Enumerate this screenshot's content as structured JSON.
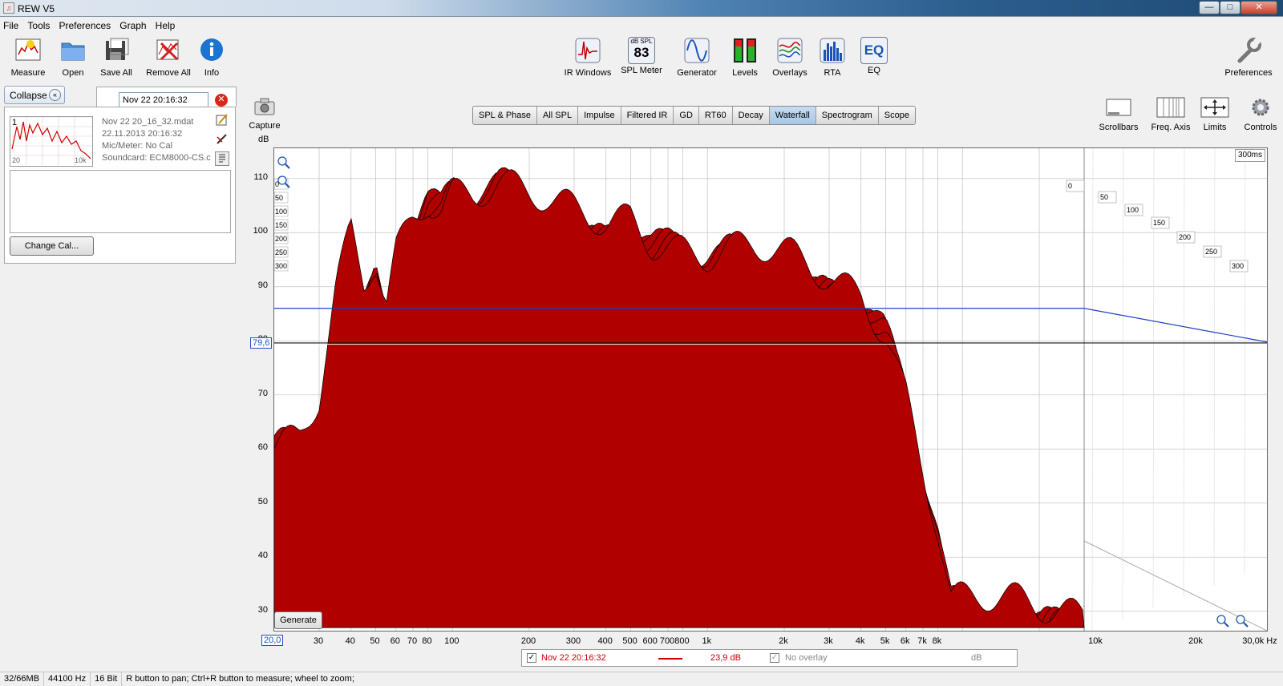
{
  "window": {
    "title": "REW V5",
    "min_glyph": "—",
    "max_glyph": "□",
    "close_glyph": "✕"
  },
  "menu": [
    "File",
    "Tools",
    "Preferences",
    "Graph",
    "Help"
  ],
  "toolbar_left": [
    {
      "label": "Measure",
      "icon": "measure-icon"
    },
    {
      "label": "Open",
      "icon": "folder-open-icon"
    },
    {
      "label": "Save All",
      "icon": "save-icon"
    },
    {
      "label": "Remove All",
      "icon": "remove-all-icon"
    },
    {
      "label": "Info",
      "icon": "info-icon"
    }
  ],
  "toolbar_center": [
    {
      "label": "IR Windows",
      "icon": "ir-windows-icon"
    },
    {
      "label": "SPL Meter",
      "icon": "spl-meter-icon",
      "badge_top": "dB SPL",
      "badge_value": "83"
    },
    {
      "label": "Generator",
      "icon": "generator-icon"
    },
    {
      "label": "Levels",
      "icon": "levels-icon"
    },
    {
      "label": "Overlays",
      "icon": "overlays-icon"
    },
    {
      "label": "RTA",
      "icon": "rta-icon"
    },
    {
      "label": "EQ",
      "icon": "eq-icon",
      "badge_value": "EQ"
    }
  ],
  "toolbar_right": {
    "label": "Preferences",
    "icon": "wrench-icon"
  },
  "graph_controls": [
    {
      "label": "Scrollbars",
      "icon": "scrollbars-icon"
    },
    {
      "label": "Freq. Axis",
      "icon": "freq-axis-icon"
    },
    {
      "label": "Limits",
      "icon": "limits-icon"
    },
    {
      "label": "Controls",
      "icon": "gear-icon"
    }
  ],
  "capture": {
    "label": "Capture",
    "icon": "camera-icon"
  },
  "left_panel": {
    "collapse_label": "Collapse",
    "measurement_name": "Nov 22 20:16:32",
    "thumb_index": "1",
    "thumb_x_min": "20",
    "thumb_x_max": "10k",
    "info": [
      "Nov 22 20_16_32.mdat",
      "22.11.2013 20:16:32",
      "Mic/Meter: No Cal",
      "Soundcard: ECM8000-CS.c"
    ],
    "change_cal_label": "Change Cal..."
  },
  "graph_tabs": [
    {
      "label": "SPL & Phase",
      "active": false
    },
    {
      "label": "All SPL",
      "active": false
    },
    {
      "label": "Impulse",
      "active": false
    },
    {
      "label": "Filtered IR",
      "active": false
    },
    {
      "label": "GD",
      "active": false
    },
    {
      "label": "RT60",
      "active": false
    },
    {
      "label": "Decay",
      "active": false
    },
    {
      "label": "Waterfall",
      "active": true
    },
    {
      "label": "Spectrogram",
      "active": false
    },
    {
      "label": "Scope",
      "active": false
    }
  ],
  "chart_data": {
    "type": "area",
    "ylabel": "dB",
    "y_ticks": [
      "110",
      "100",
      "90",
      "80",
      "70",
      "60",
      "50",
      "40",
      "30"
    ],
    "ylim": [
      27,
      115
    ],
    "x_scale": "log",
    "x_ticks": [
      "30",
      "40",
      "50",
      "60",
      "70",
      "80",
      "100",
      "200",
      "300",
      "400",
      "500",
      "600",
      "700",
      "800",
      "1k",
      "2k",
      "3k",
      "4k",
      "5k",
      "6k",
      "7k",
      "8k",
      "10k",
      "20k",
      "30,0k Hz"
    ],
    "x_tick_values": [
      30,
      40,
      50,
      60,
      70,
      80,
      100,
      200,
      300,
      400,
      500,
      600,
      700,
      800,
      1000,
      2000,
      3000,
      4000,
      5000,
      6000,
      7000,
      8000,
      10000,
      20000,
      30000
    ],
    "xlim": [
      20,
      30000
    ],
    "x_min_label": "20,0",
    "y_marker_label": "79,6",
    "y_marker_value": 79.6,
    "limit_line_value": 86,
    "time_window_label": "300ms",
    "time_slices": [
      "0",
      "50",
      "100",
      "150",
      "200",
      "250",
      "300"
    ],
    "fill_color": "#b00000",
    "line_color": "#000000",
    "front_slice": {
      "freqs": [
        20,
        25,
        30,
        35,
        40,
        45,
        50,
        55,
        60,
        70,
        80,
        90,
        100,
        120,
        150,
        200,
        250,
        300,
        400,
        500,
        600,
        700,
        800,
        1000,
        1500,
        2000,
        3000,
        4000,
        5000,
        6000,
        7000,
        8000,
        9000
      ],
      "db": [
        60,
        61,
        68,
        88,
        99,
        90,
        95,
        87,
        97,
        104,
        108,
        106,
        109,
        108,
        109,
        106,
        104,
        103,
        102,
        104,
        100,
        99,
        98,
        96,
        96,
        95,
        92,
        90,
        83,
        71,
        57,
        45,
        31
      ]
    }
  },
  "graph_buttons": {
    "generate_label": "Generate"
  },
  "legend": {
    "meas_name": "Nov 22 20:16:32",
    "meas_color": "#cc0000",
    "meas_value": "23,9 dB",
    "overlay_label": "No overlay",
    "overlay_unit": "dB"
  },
  "status": [
    "32/66MB",
    "44100 Hz",
    "16 Bit",
    "R button to pan; Ctrl+R button to measure; wheel to zoom;"
  ]
}
